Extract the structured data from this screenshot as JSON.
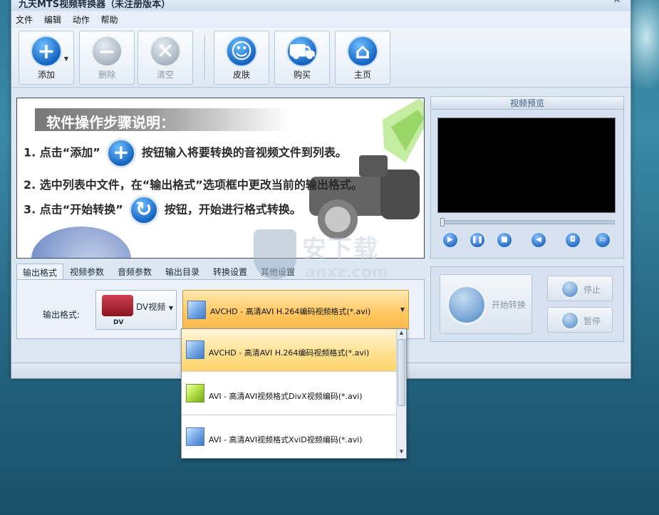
{
  "window": {
    "title": "九天MTS视频转换器（未注册版本）",
    "close": "✕"
  },
  "menu": [
    "文件",
    "编辑",
    "动作",
    "帮助"
  ],
  "toolbar": {
    "add": "添加",
    "delete": "删除",
    "clear": "清空",
    "skin": "皮肤",
    "buy": "购买",
    "home": "主页"
  },
  "instructions": {
    "heading": "软件操作步骤说明：",
    "step1_pre": "1. 点击“添加”",
    "step1_post": "按钮输入将要转换的音视频文件到列表。",
    "step2": "2. 选中列表中文件，在“输出格式”选项框中更改当前的输出格式。",
    "step3_pre": "3. 点击“开始转换”",
    "step3_post": "按钮，开始进行格式转换。"
  },
  "preview": {
    "title": "视频预览"
  },
  "tabs": [
    "输出格式",
    "视频参数",
    "音频参数",
    "输出目录",
    "转换设置",
    "其他设置"
  ],
  "output": {
    "label": "输出格式:",
    "device_name": "DV视频",
    "device_tag": "DV",
    "selected_format": "AVCHD - 高清AVI H.264编码视频格式(*.avi)"
  },
  "actions": {
    "start": "开始转换",
    "stop": "停止",
    "pause": "暂停"
  },
  "dropdown": {
    "items": [
      {
        "label": "AVCHD - 高清AVI H.264编码视频格式(*.avi)",
        "icon": "blue-cube-icon"
      },
      {
        "label": "AVI - 高清AVI视频格式DivX视频编码(*.avi)",
        "icon": "green-cube-icon"
      },
      {
        "label": "AVI - 高清AVI视频格式XviD视频编码(*.avi)",
        "icon": "blue-cube-icon"
      }
    ]
  },
  "watermark": {
    "cn": "安下载",
    "en": "anxz.com"
  }
}
